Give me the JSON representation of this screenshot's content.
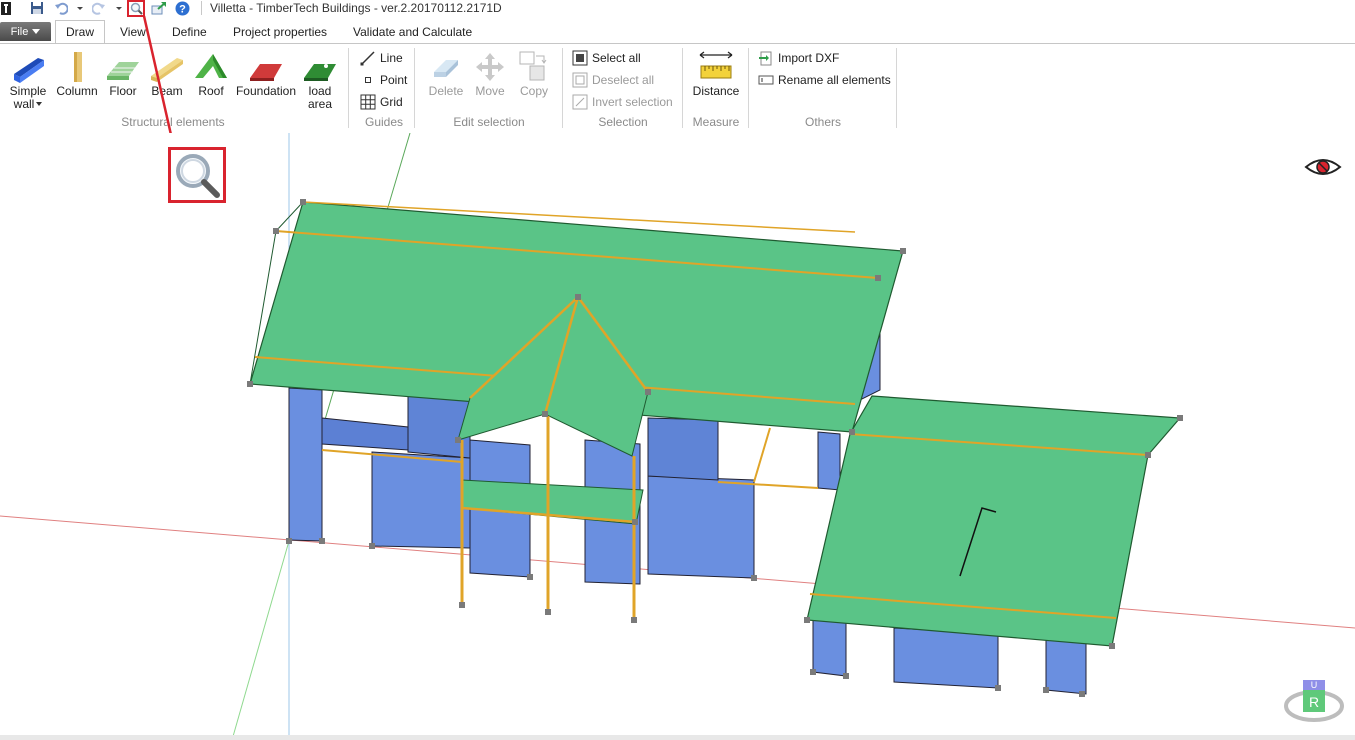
{
  "window": {
    "title": "Villetta - TimberTech Buildings - ver.2.20170112.2171D"
  },
  "quick_access": {
    "icons": [
      "app-icon",
      "save-icon",
      "undo-icon",
      "redo-icon",
      "zoom-icon",
      "export-icon",
      "help-icon"
    ]
  },
  "tabs": {
    "file": "File",
    "items": [
      "Draw",
      "View",
      "Define",
      "Project properties",
      "Validate and Calculate"
    ],
    "active": "Draw"
  },
  "ribbon": {
    "structural": {
      "label": "Structural elements",
      "simple_wall_1": "Simple",
      "simple_wall_2": "wall",
      "column": "Column",
      "floor": "Floor",
      "beam": "Beam",
      "roof": "Roof",
      "foundation": "Foundation",
      "load_area_1": "load",
      "load_area_2": "area"
    },
    "guides": {
      "label": "Guides",
      "line": "Line",
      "point": "Point",
      "grid": "Grid"
    },
    "edit_selection": {
      "label": "Edit selection",
      "delete": "Delete",
      "move": "Move",
      "copy": "Copy"
    },
    "selection": {
      "label": "Selection",
      "select_all": "Select all",
      "deselect_all": "Deselect all",
      "invert": "Invert selection"
    },
    "measure": {
      "label": "Measure",
      "distance": "Distance"
    },
    "others": {
      "label": "Others",
      "import_dxf": "Import DXF",
      "rename_all": "Rename all elements"
    }
  },
  "viewport": {
    "nav_cube": {
      "top": "U",
      "front": "R"
    },
    "colors": {
      "wall": "#6a8fe0",
      "roof": "#5ac487",
      "beam": "#e0a428",
      "node": "#7a7a7a",
      "callout": "#d9232e"
    }
  }
}
